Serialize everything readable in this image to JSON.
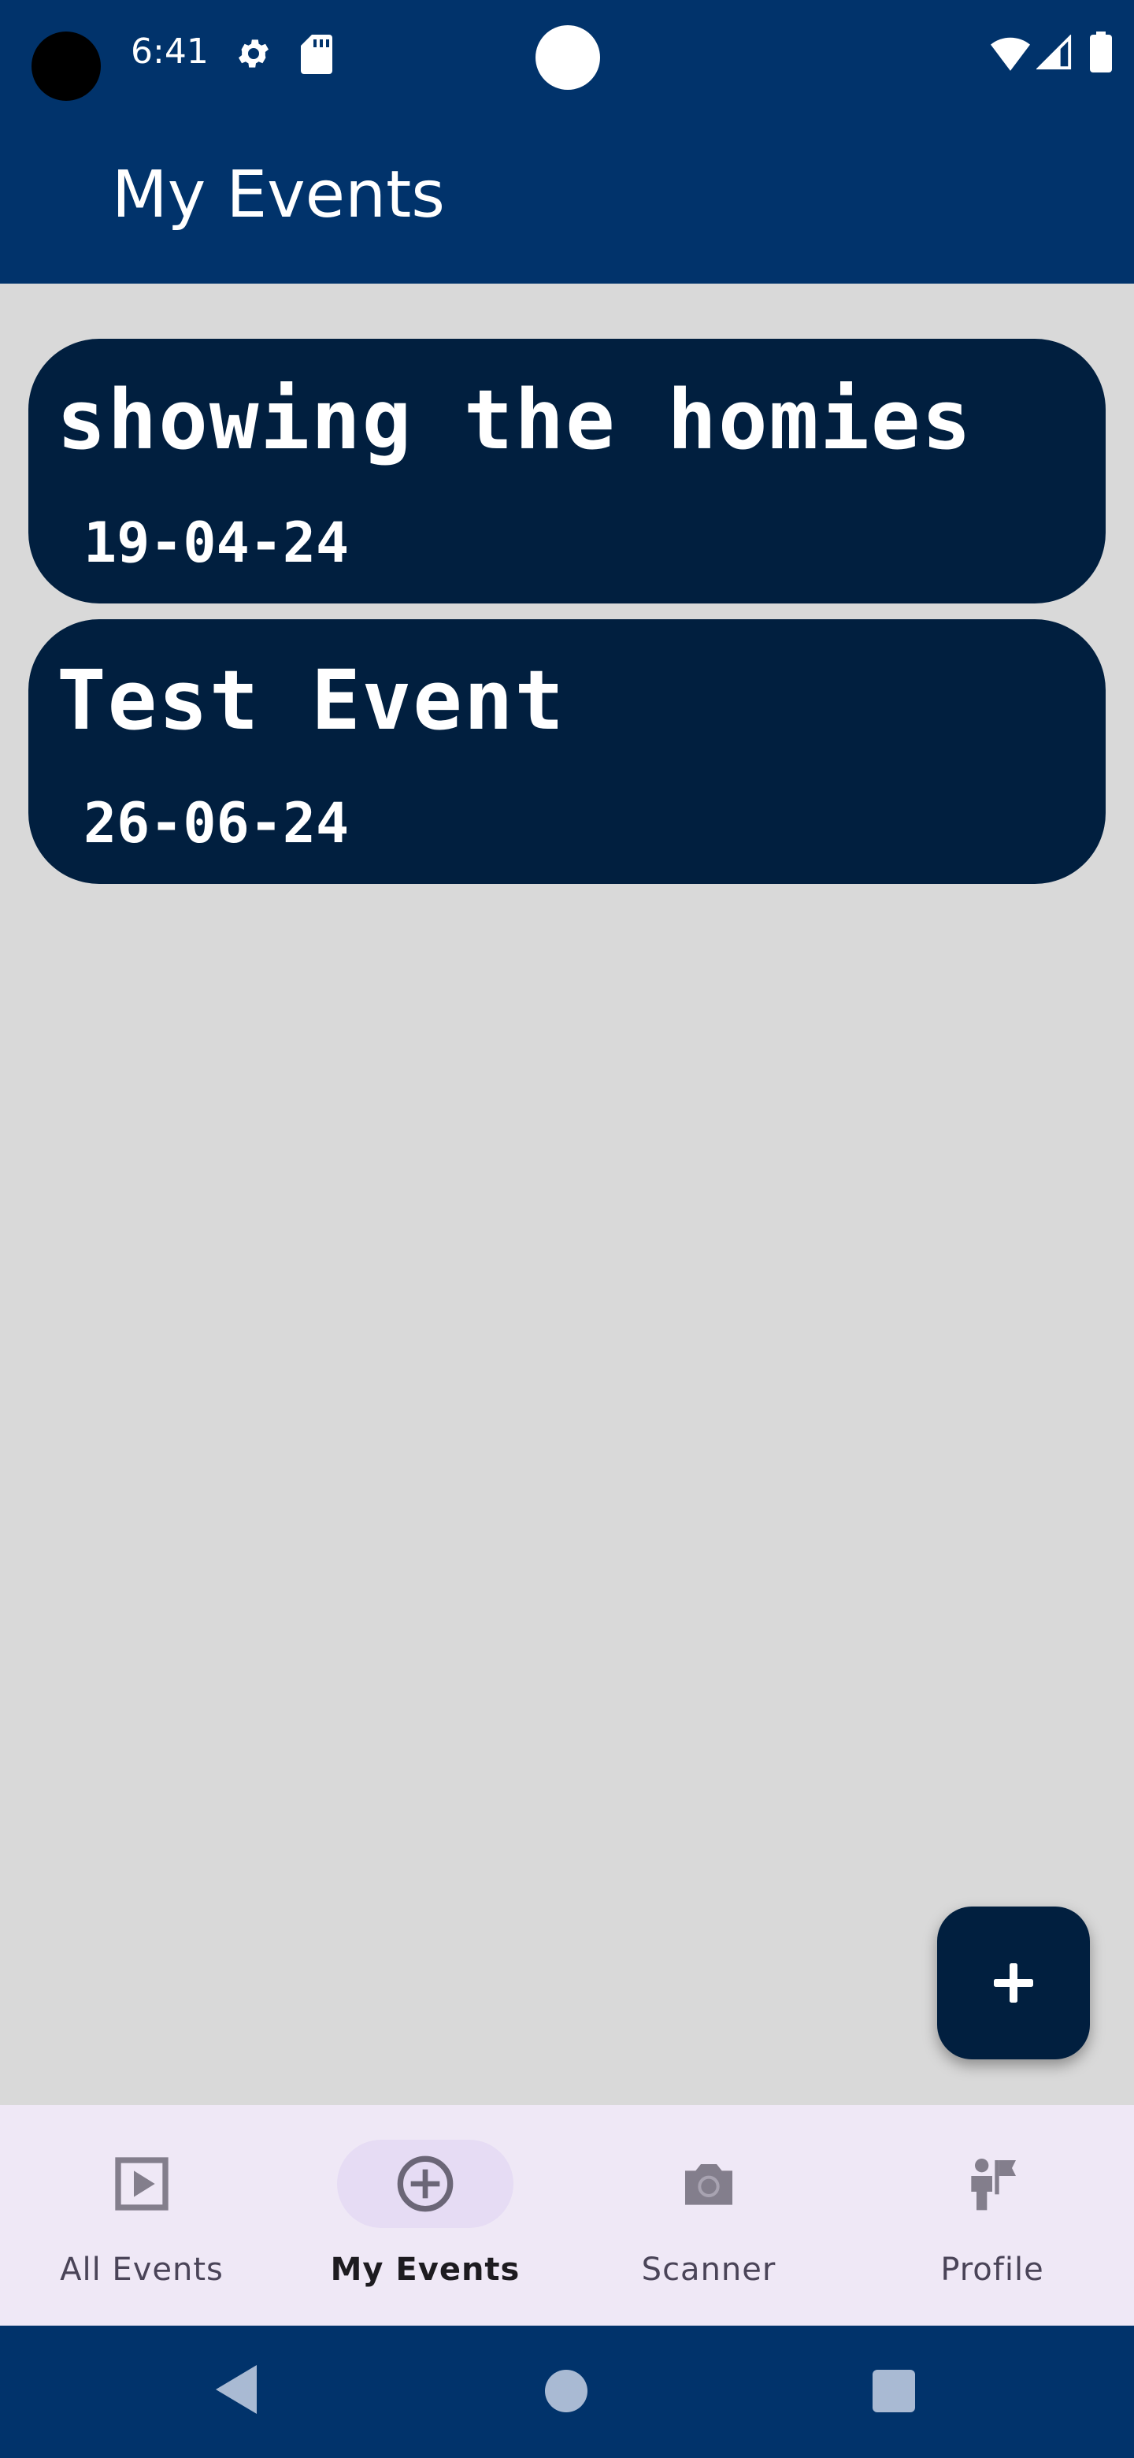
{
  "status_bar": {
    "time": "6:41",
    "icons": [
      "gear-icon",
      "sd-card-icon",
      "wifi-icon",
      "cell-signal-icon",
      "battery-icon"
    ]
  },
  "app_bar": {
    "title": "My Events"
  },
  "events": [
    {
      "name": "showing the homies",
      "date": "19-04-24"
    },
    {
      "name": "Test Event",
      "date": "26-06-24"
    }
  ],
  "fab": {
    "icon": "plus-icon"
  },
  "bottom_nav": {
    "items": [
      {
        "label": "All Events",
        "icon": "play-box-icon",
        "active": false
      },
      {
        "label": "My Events",
        "icon": "add-circle-icon",
        "active": true
      },
      {
        "label": "Scanner",
        "icon": "camera-icon",
        "active": false
      },
      {
        "label": "Profile",
        "icon": "person-flag-icon",
        "active": false
      }
    ]
  },
  "colors": {
    "header": "#01336b",
    "card": "#011f3f",
    "background": "#d9d9d9",
    "nav_background": "#efe8f6",
    "nav_active_pill": "#e6dcf4"
  }
}
